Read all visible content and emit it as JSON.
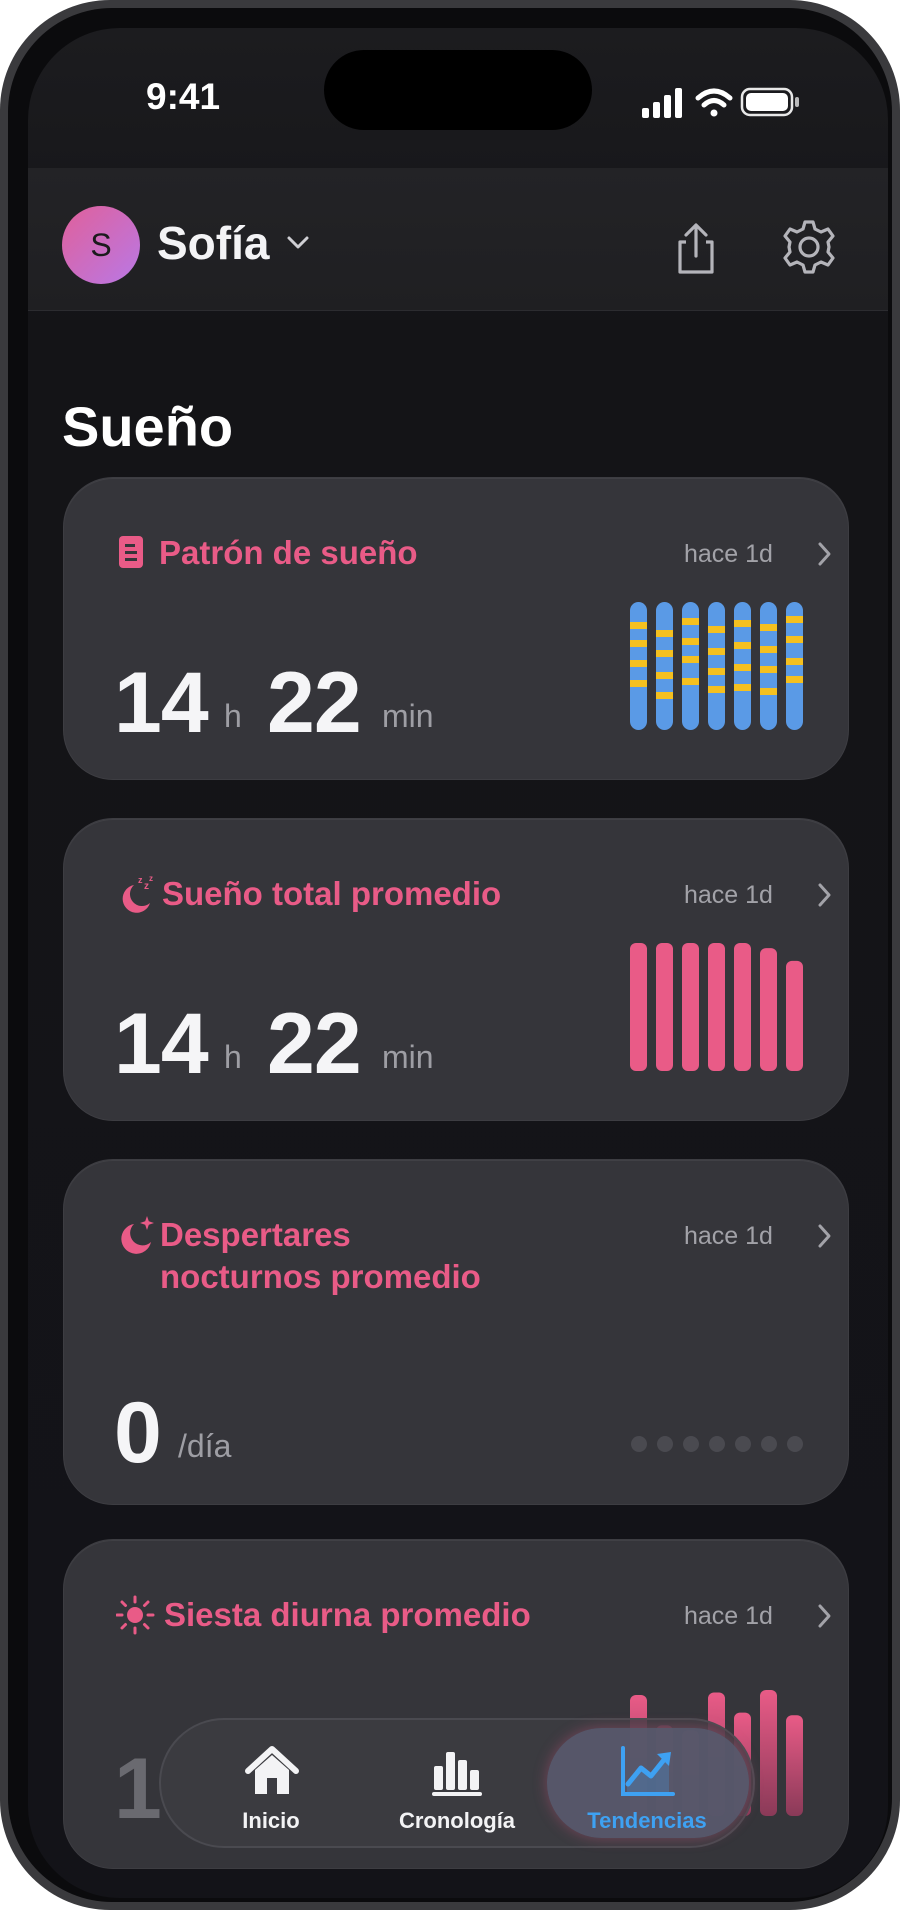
{
  "status_bar": {
    "time": "9:41"
  },
  "header": {
    "avatar_initial": "S",
    "user_name": "Sofía"
  },
  "section": {
    "title": "Sueño"
  },
  "colors": {
    "accent": "#e95b87",
    "sleep_blue": "#5a9ae6",
    "sleep_yellow": "#f4c020",
    "tab_active": "#3ea1f2"
  },
  "cards": [
    {
      "title": "Patrón de sueño",
      "ago": "hace 1d",
      "value_h": "14",
      "unit_h": "h",
      "value_m": "22",
      "unit_m": "min",
      "icon": "document-icon"
    },
    {
      "title": "Sueño total promedio",
      "ago": "hace 1d",
      "value_h": "14",
      "unit_h": "h",
      "value_m": "22",
      "unit_m": "min",
      "icon": "moon-zzz-icon",
      "bars": [
        1.0,
        1.0,
        1.0,
        1.0,
        1.0,
        0.96,
        0.86
      ]
    },
    {
      "title_line1": "Despertares",
      "title_line2": "nocturnos promedio",
      "ago": "hace 1d",
      "value": "0",
      "unit": "/día",
      "icon": "moon-star-icon"
    },
    {
      "title": "Siesta diurna promedio",
      "ago": "hace 1d",
      "value": "1",
      "icon": "sun-icon",
      "bars": [
        0.96,
        0.72,
        0.68,
        0.98,
        0.82,
        1.0,
        0.8
      ]
    }
  ],
  "tabbar": {
    "tabs": [
      {
        "label": "Inicio",
        "icon": "home-icon"
      },
      {
        "label": "Cronología",
        "icon": "bar-chart-icon"
      },
      {
        "label": "Tendencias",
        "icon": "trend-chart-icon",
        "active": true
      }
    ]
  }
}
